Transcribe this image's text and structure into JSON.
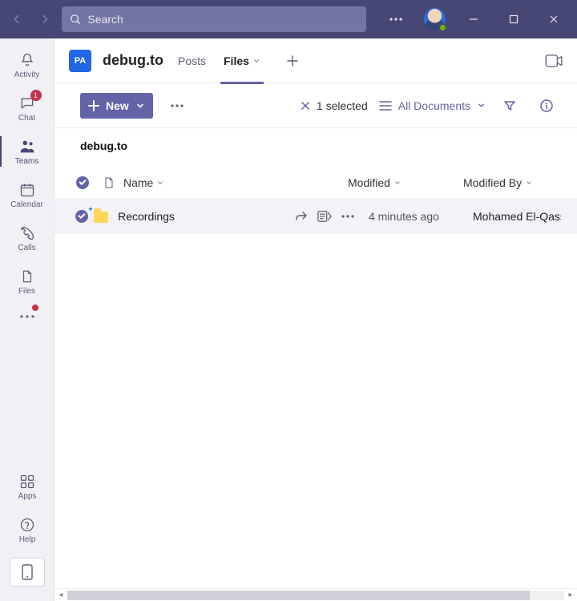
{
  "titlebar": {
    "search_placeholder": "Search"
  },
  "rail": {
    "items": [
      {
        "label": "Activity"
      },
      {
        "label": "Chat",
        "badge": "1"
      },
      {
        "label": "Teams"
      },
      {
        "label": "Calendar"
      },
      {
        "label": "Calls"
      },
      {
        "label": "Files"
      }
    ],
    "apps_label": "Apps",
    "help_label": "Help"
  },
  "channel": {
    "team_initials": "PA",
    "title": "debug.to",
    "tabs": {
      "posts": "Posts",
      "files": "Files"
    }
  },
  "command": {
    "new_label": "New",
    "selected_label": "1 selected",
    "view_label": "All Documents"
  },
  "library": {
    "title": "debug.to"
  },
  "columns": {
    "name": "Name",
    "modified": "Modified",
    "modified_by": "Modified By"
  },
  "rows": [
    {
      "name": "Recordings",
      "modified": "4 minutes ago",
      "modified_by": "Mohamed El-Qass"
    }
  ]
}
